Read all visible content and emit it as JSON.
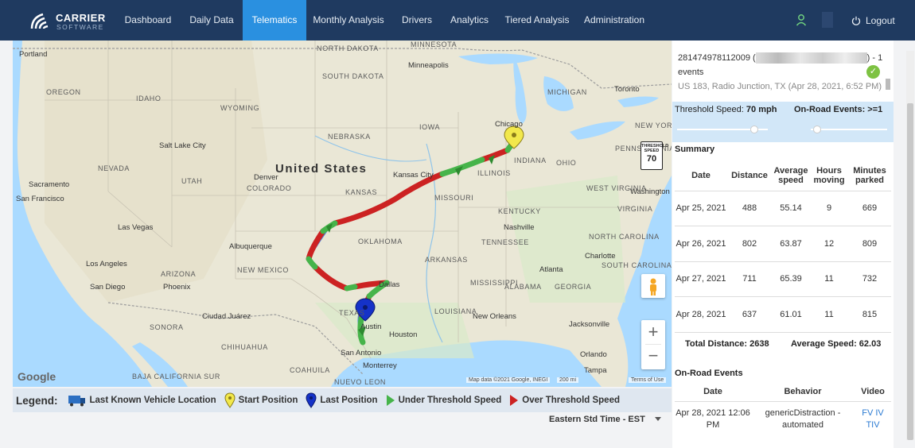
{
  "brand": {
    "name": "CARRIER",
    "sub": "SOFTWARE"
  },
  "nav": {
    "items": [
      "Dashboard",
      "Daily Data",
      "Telematics",
      "Monthly Analysis",
      "Drivers",
      "Analytics",
      "Tiered Analysis",
      "Administration"
    ],
    "active": "Telematics",
    "logout": "Logout"
  },
  "map": {
    "country_label": "United States",
    "state_labels": [
      "SOUTH DAKOTA",
      "NORTH DAKOTA",
      "OREGON",
      "IDAHO",
      "WYOMING",
      "NEBRASKA",
      "IOWA",
      "MICHIGAN",
      "NEVADA",
      "UTAH",
      "COLORADO",
      "KANSAS",
      "MISSOURI",
      "ILLINOIS",
      "INDIANA",
      "OHIO",
      "PENNSYLVANIA",
      "WEST VIRGINIA",
      "VIRGINIA",
      "KENTUCKY",
      "TENNESSEE",
      "NORTH CAROLINA",
      "ARIZONA",
      "NEW MEXICO",
      "OKLAHOMA",
      "ARKANSAS",
      "MISSISSIPPI",
      "ALABAMA",
      "GEORGIA",
      "SOUTH CAROLINA",
      "LOUISIANA",
      "TEXAS",
      "CHIHUAHUA",
      "SONORA",
      "BAJA CALIFORNIA SUR",
      "COAHUILA",
      "NUEVO LEON",
      "MINNESOTA",
      "NEW YORK"
    ],
    "cities": [
      "Portland",
      "Minneapolis",
      "Toronto",
      "Chicago",
      "Salt Lake City",
      "Sacramento",
      "San Francisco",
      "Las Vegas",
      "Los Angeles",
      "San Diego",
      "Phoenix",
      "Albuquerque",
      "Denver",
      "Kansas City",
      "Nashville",
      "Atlanta",
      "Charlotte",
      "Washington",
      "Dallas",
      "Austin",
      "Houston",
      "San Antonio",
      "Jacksonville",
      "Orlando",
      "Tampa",
      "Ciudad Juárez",
      "Monterrey",
      "New Orleans"
    ],
    "speed_sign": {
      "top": "THRESHOLD SPEED",
      "value": "70"
    },
    "attribution": "Map data ©2021 Google, INEGI",
    "scale": "200 mi",
    "terms": "Terms of Use",
    "google": "Google",
    "zoom_in": "+",
    "zoom_out": "−"
  },
  "legend": {
    "title": "Legend:",
    "items": [
      "Last Known Vehicle Location",
      "Start Position",
      "Last Position",
      "Under Threshold Speed",
      "Over Threshold Speed"
    ]
  },
  "timezone": "Eastern Std Time - EST",
  "panel": {
    "event_id": "281474978112009 (",
    "event_suffix": ") - 1",
    "event_events": "events",
    "event_address": "US 183, Radio Junction, TX (Apr 28, 2021, 6:52 PM)",
    "threshold_label": "Threshold Speed:",
    "threshold_value": "70 mph",
    "onroad_label": "On-Road Events:",
    "onroad_value": ">=1",
    "threshold_slider_fraction": 0.85,
    "onroad_slider_fraction": 0.03,
    "summary_title": "Summary",
    "summary_headers": [
      "Date",
      "Distance",
      "Average speed",
      "Hours moving",
      "Minutes parked"
    ],
    "summary_rows": [
      {
        "date": "Apr 25, 2021",
        "distance": "488",
        "avg": "55.14",
        "hours": "9",
        "minutes": "669"
      },
      {
        "date": "Apr 26, 2021",
        "distance": "802",
        "avg": "63.87",
        "hours": "12",
        "minutes": "809"
      },
      {
        "date": "Apr 27, 2021",
        "distance": "711",
        "avg": "65.39",
        "hours": "11",
        "minutes": "732"
      },
      {
        "date": "Apr 28, 2021",
        "distance": "637",
        "avg": "61.01",
        "hours": "11",
        "minutes": "815"
      }
    ],
    "total_distance": "Total Distance: 2638",
    "average_speed": "Average Speed: 62.03",
    "events_title": "On-Road Events",
    "events_headers": [
      "Date",
      "Behavior",
      "Video"
    ],
    "events_rows": [
      {
        "date": "Apr 28, 2021 12:06 PM",
        "behavior": "genericDistraction - automated",
        "video": [
          "FV",
          "IV",
          "TIV"
        ]
      }
    ]
  }
}
